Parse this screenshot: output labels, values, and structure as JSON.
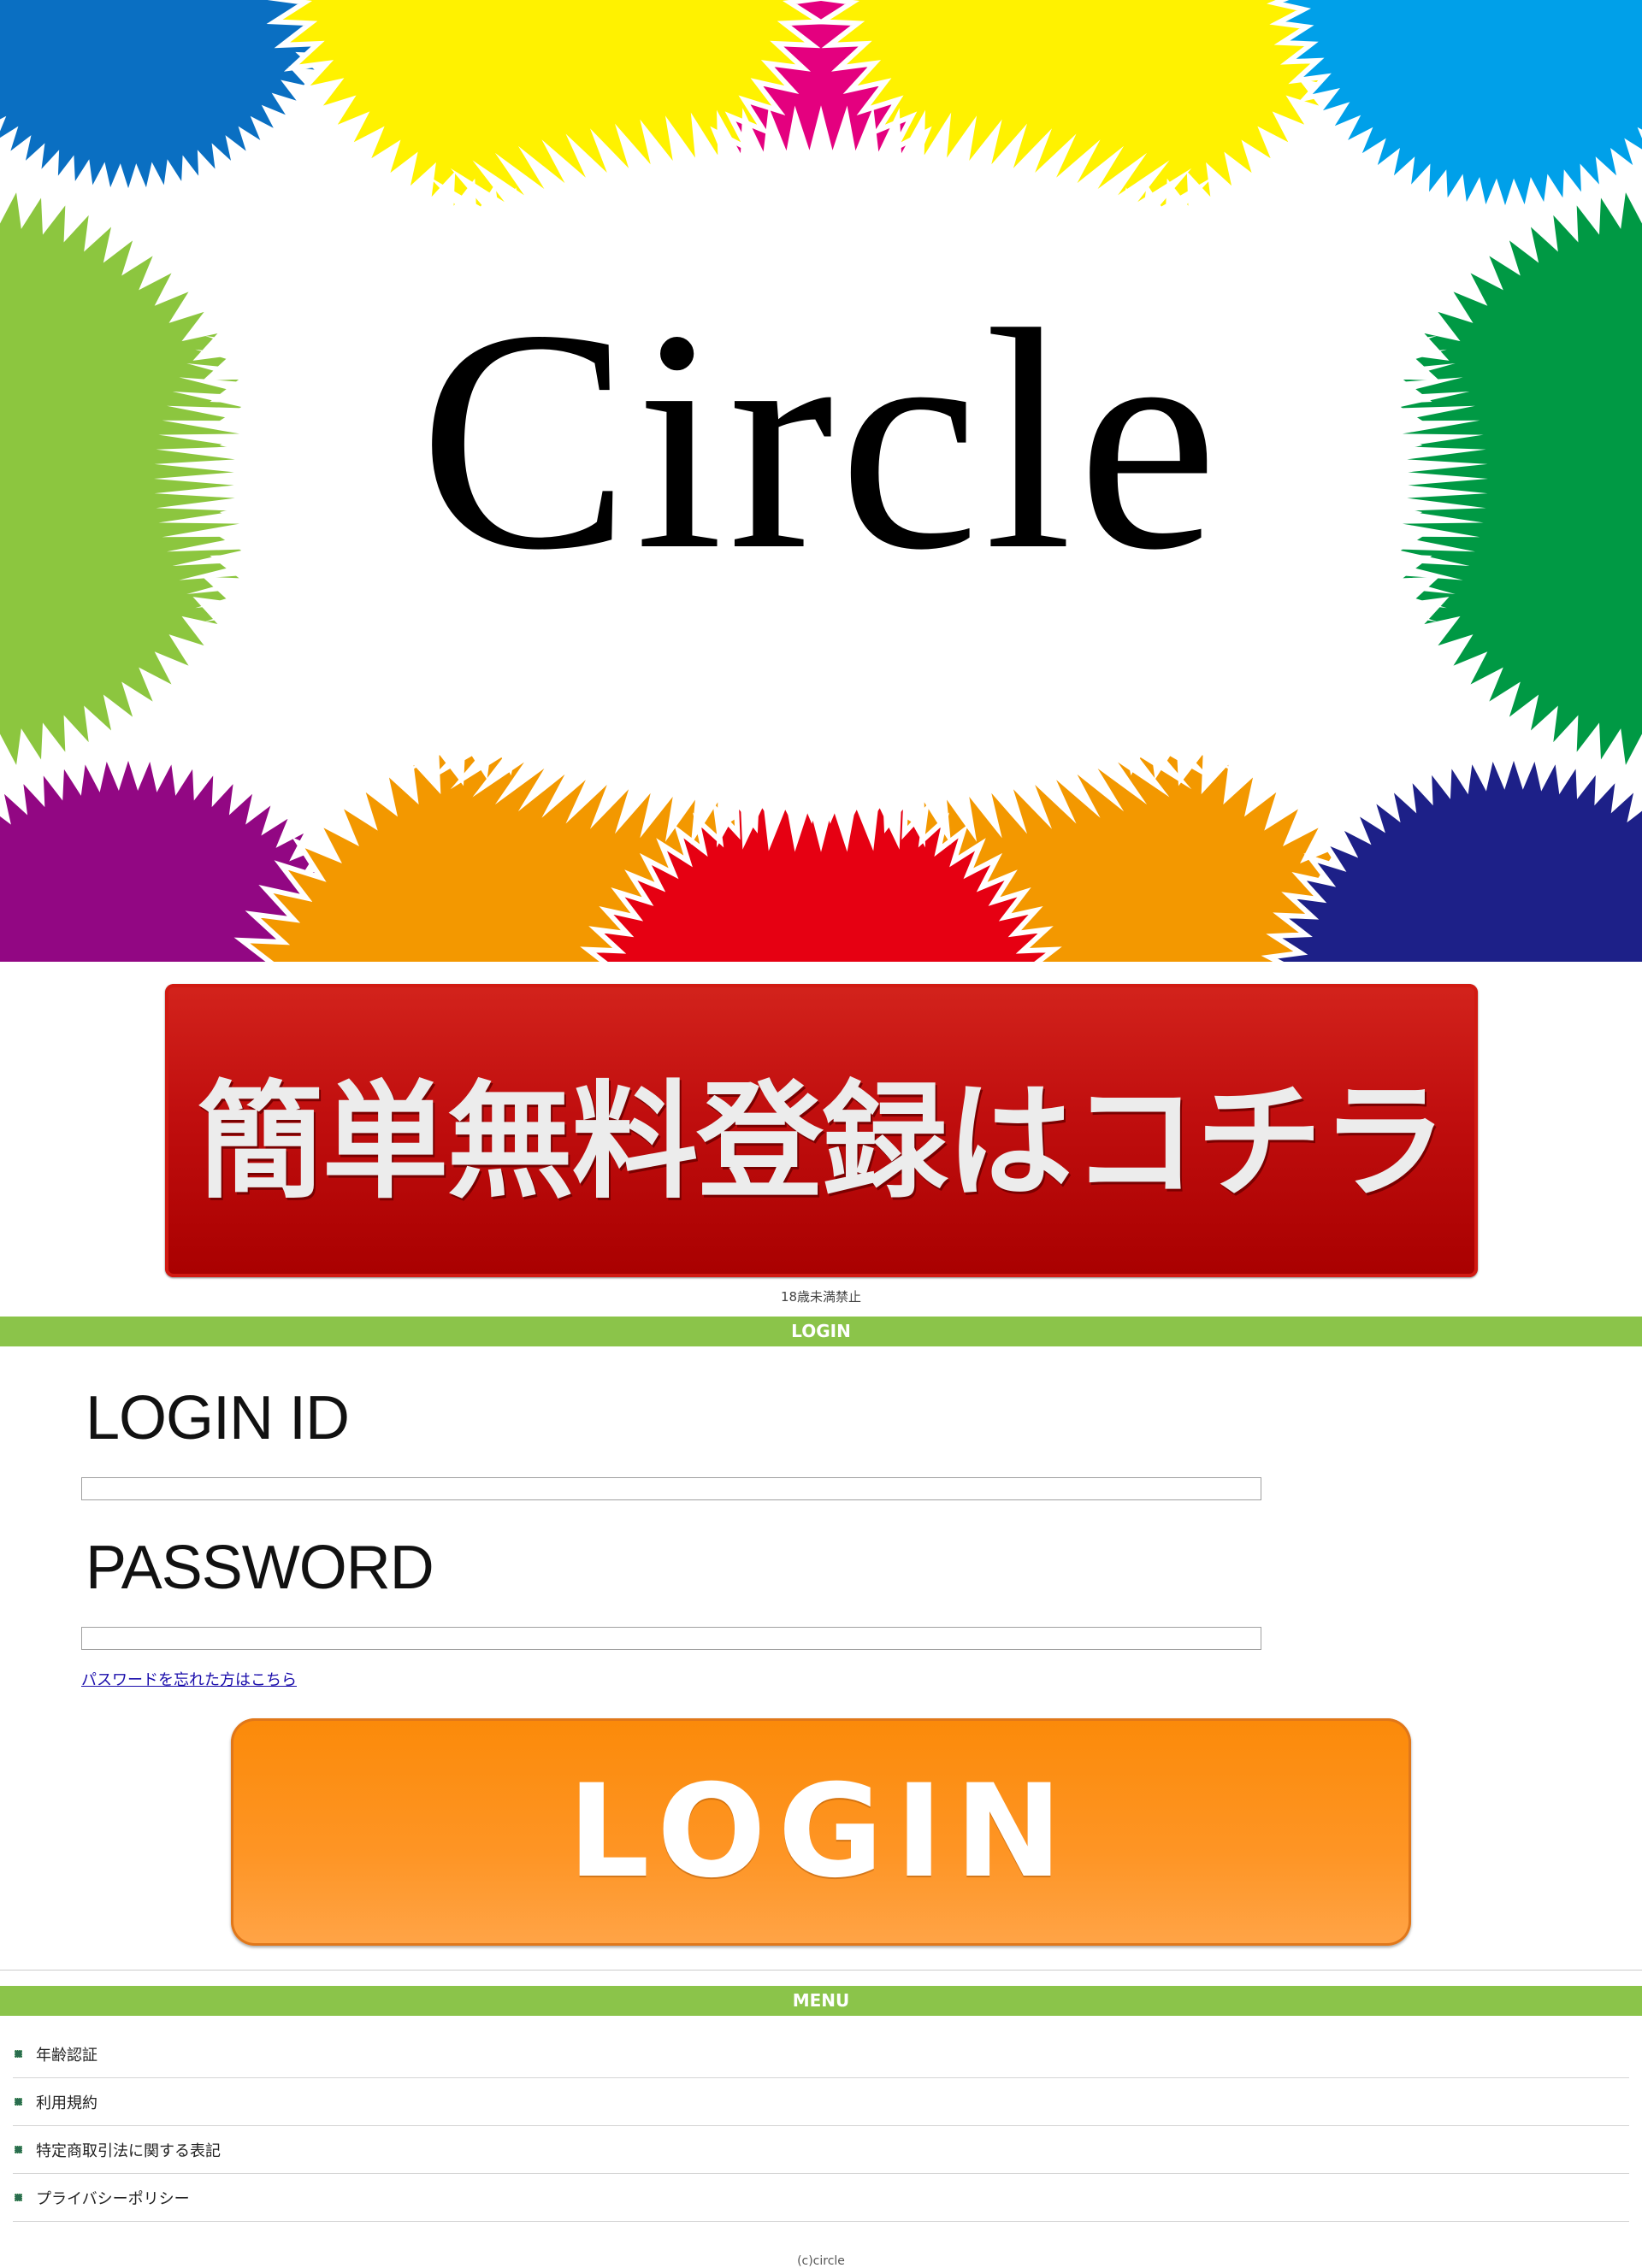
{
  "hero": {
    "title": "Circle"
  },
  "register": {
    "label": "簡単無料登録はコチラ"
  },
  "age_notice": "18歳未満禁止",
  "login_section": {
    "header": "LOGIN",
    "id_label": "LOGIN ID",
    "password_label": "PASSWORD",
    "id_value": "",
    "password_value": "",
    "forgot_link": "パスワードを忘れた方はこちら",
    "button": "LOGIN"
  },
  "menu": {
    "header": "MENU",
    "items": [
      {
        "label": "年齢認証"
      },
      {
        "label": "利用規約"
      },
      {
        "label": "特定商取引法に関する表記"
      },
      {
        "label": "プライバシーポリシー"
      }
    ]
  },
  "footer": {
    "copyright": "(c)circle"
  },
  "colors": {
    "accent_green": "#8bc44a",
    "register_red": "#c00e0e",
    "login_orange": "#fe9525",
    "burst_colors": [
      "#0a6fc2",
      "#e4007f",
      "#fff200",
      "#00a0e9",
      "#8cc63f",
      "#009944",
      "#920783",
      "#f39800",
      "#e60012",
      "#1d2088"
    ]
  }
}
